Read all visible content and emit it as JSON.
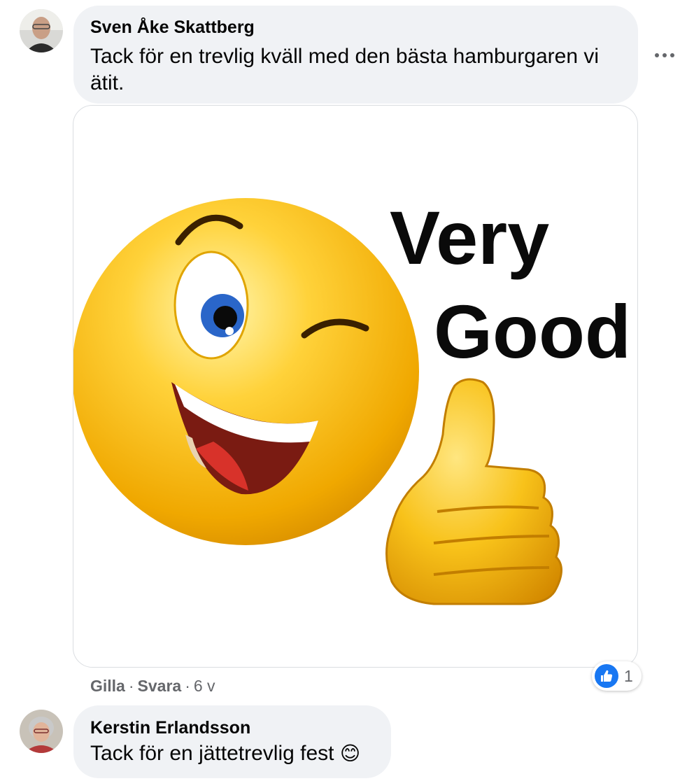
{
  "comments": [
    {
      "author": "Sven Åke Skattberg",
      "text": "Tack för en trevlig kväll med den bästa hamburgaren vi ätit.",
      "attachment": {
        "type": "gif",
        "caption_line1": "Very",
        "caption_line2": "Good"
      },
      "actions": {
        "like": "Gilla",
        "reply": "Svara",
        "separator": "·",
        "time": "6 v"
      },
      "reactions": {
        "icon": "like-icon",
        "count": "1"
      }
    },
    {
      "author": "Kerstin Erlandsson",
      "text": "Tack för en jättetrevlig fest",
      "emoji": "😊"
    }
  ],
  "colors": {
    "bubble": "#f0f2f5",
    "secondary_text": "#65676b",
    "like_blue": "#1877f2"
  }
}
